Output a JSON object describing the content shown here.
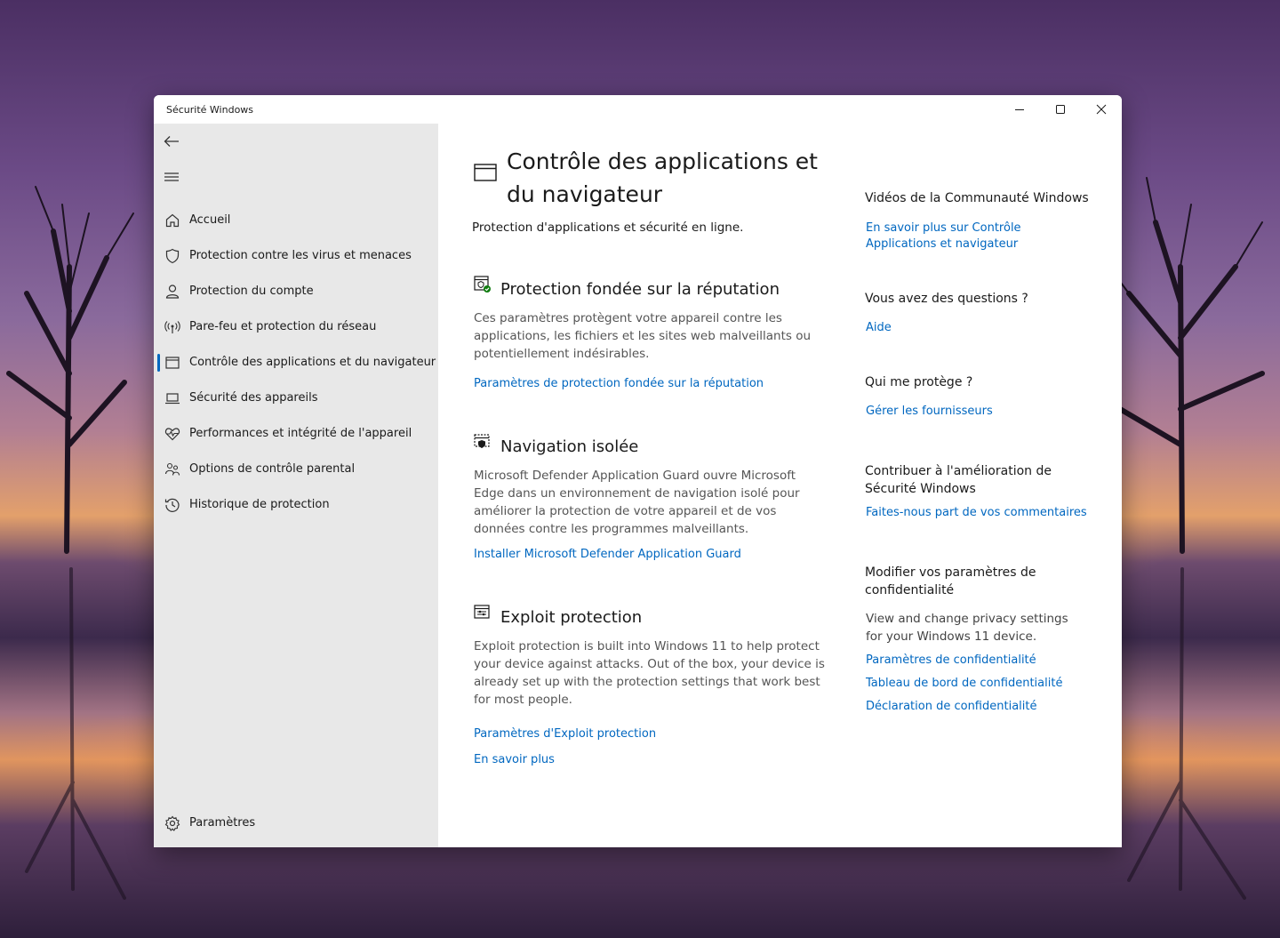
{
  "window": {
    "title": "Sécurité Windows",
    "accent_color": "#0067c0"
  },
  "sidebar": {
    "back_icon": "back-arrow-icon",
    "menu_icon": "hamburger-icon",
    "items": [
      {
        "label": "Accueil",
        "icon": "home-icon",
        "active": false
      },
      {
        "label": "Protection contre les virus et menaces",
        "icon": "shield-icon",
        "active": false
      },
      {
        "label": "Protection du compte",
        "icon": "person-icon",
        "active": false
      },
      {
        "label": "Pare-feu et protection du réseau",
        "icon": "antenna-icon",
        "active": false
      },
      {
        "label": "Contrôle des applications et du navigateur",
        "icon": "app-window-icon",
        "active": true
      },
      {
        "label": "Sécurité des appareils",
        "icon": "laptop-icon",
        "active": false
      },
      {
        "label": "Performances et intégrité de l'appareil",
        "icon": "heart-pulse-icon",
        "active": false
      },
      {
        "label": "Options de contrôle parental",
        "icon": "family-icon",
        "active": false
      },
      {
        "label": "Historique de protection",
        "icon": "history-icon",
        "active": false
      }
    ],
    "settings_label": "Paramètres"
  },
  "main": {
    "title_line1": "Contrôle des applications et",
    "title_line2": "du navigateur",
    "subtitle": "Protection d'applications et sécurité en ligne.",
    "sections": [
      {
        "title": "Protection fondée sur la réputation",
        "description": "Ces paramètres protègent votre appareil contre les applications, les fichiers et les sites web malveillants ou potentiellement indésirables.",
        "links": [
          "Paramètres de protection fondée sur la réputation"
        ]
      },
      {
        "title": "Navigation isolée",
        "description": "Microsoft Defender Application Guard ouvre Microsoft Edge dans un environnement de navigation isolé pour améliorer la protection de votre appareil et de vos données contre les programmes malveillants.",
        "links": [
          "Installer Microsoft Defender Application Guard"
        ]
      },
      {
        "title": "Exploit protection",
        "description": "Exploit protection is built into Windows 11 to help protect your device against attacks.  Out of the box, your device is already set up with the protection settings that work best for most people.",
        "links": [
          "Paramètres d'Exploit protection",
          "En savoir plus"
        ]
      }
    ]
  },
  "right_panel": {
    "community": {
      "heading": "Vidéos de la Communauté Windows",
      "link": "En savoir plus sur Contrôle Applications et navigateur"
    },
    "questions": {
      "heading": "Vous avez des questions ?",
      "link": "Aide"
    },
    "protects": {
      "heading": "Qui me protège ?",
      "link": "Gérer les fournisseurs"
    },
    "feedback": {
      "heading": "Contribuer à l'amélioration de Sécurité Windows",
      "link": "Faites-nous part de vos commentaires"
    },
    "privacy": {
      "heading": "Modifier vos paramètres de confidentialité",
      "text": "View and change privacy settings for your Windows 11 device.",
      "links": [
        "Paramètres de confidentialité",
        "Tableau de bord de confidentialité",
        "Déclaration de confidentialité"
      ]
    }
  }
}
